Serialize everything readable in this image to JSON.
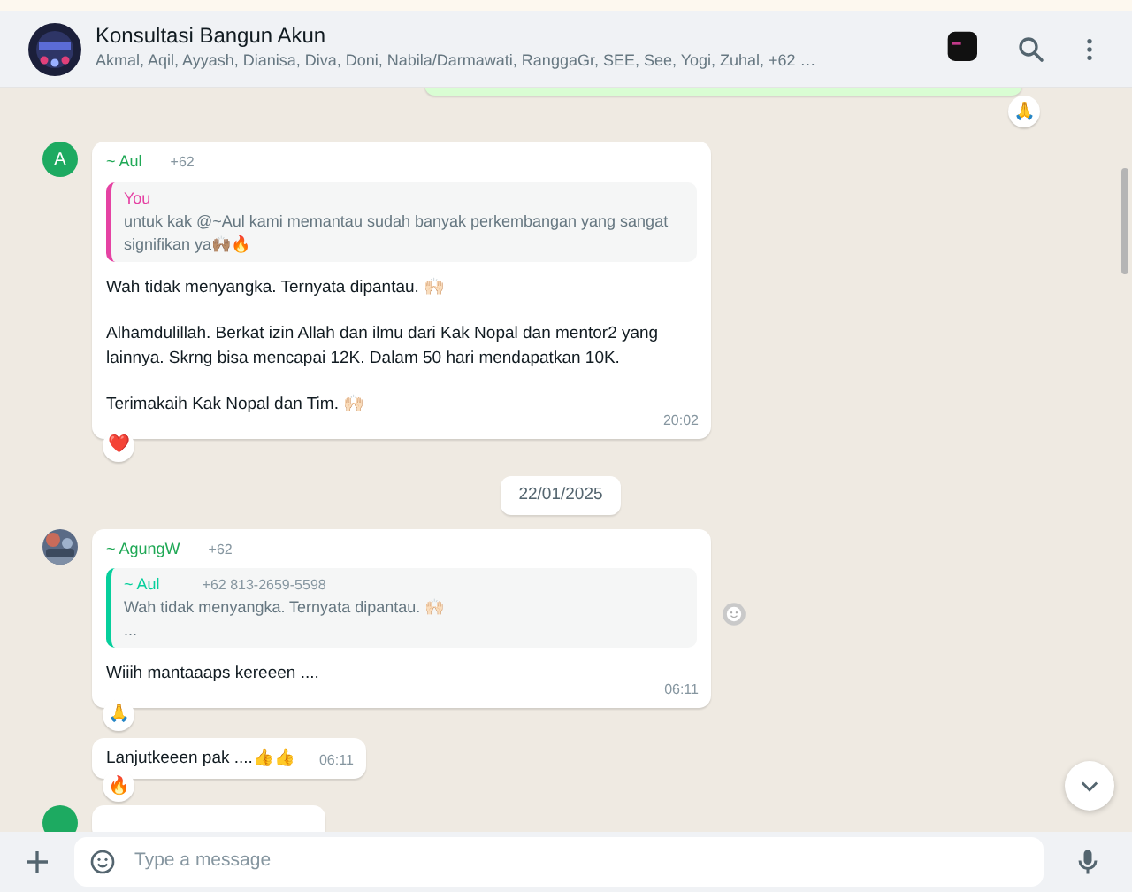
{
  "header": {
    "title": "Konsultasi Bangun Akun",
    "participants": "Akmal, Aqil, Ayyash, Dianisa, Diva, Doni, Nabila/Darmawati, RanggaGr, SEE, See, Yogi, Zuhal, +62 …"
  },
  "messages": [
    {
      "kind": "outgoing_cut",
      "reaction": "🙏"
    },
    {
      "kind": "incoming",
      "avatar": {
        "kind": "initial",
        "letter": "A"
      },
      "sender": "~ Aul",
      "phone": "+62",
      "quote": {
        "author": "You",
        "color": "#e542a3",
        "lines": [
          "untuk kak @~Aul kami memantau sudah banyak perkembangan yang sangat signifikan ya🙌🏽🔥"
        ]
      },
      "paragraphs": [
        "Wah tidak menyangka. Ternyata dipantau. 🙌🏻",
        "Alhamdulillah. Berkat izin Allah dan ilmu dari Kak Nopal dan mentor2 yang lainnya. Skrng bisa mencapai 12K. Dalam 50 hari mendapatkan 10K.",
        "Terimakaih Kak Nopal dan Tim. 🙌🏻"
      ],
      "time": "20:02",
      "reaction": "❤️"
    },
    {
      "kind": "date",
      "text": "22/01/2025"
    },
    {
      "kind": "incoming",
      "avatar": {
        "kind": "picture"
      },
      "sender": "~ AgungW",
      "phone": "+62",
      "quote": {
        "author": "~ Aul",
        "phone": "+62 813-2659-5598",
        "color": "#06cf9c",
        "lines": [
          "Wah tidak menyangka. Ternyata dipantau. 🙌🏻",
          "..."
        ]
      },
      "paragraphs": [
        "Wiiih mantaaaps kereeen ...."
      ],
      "time": "06:11",
      "reaction": "🙏",
      "react_button": true
    },
    {
      "kind": "continued",
      "paragraphs": [
        "Lanjutkeeen pak ....👍👍"
      ],
      "time": "06:11",
      "reaction": "🔥"
    },
    {
      "kind": "cut_off"
    }
  ],
  "composer": {
    "placeholder": "Type a message"
  }
}
